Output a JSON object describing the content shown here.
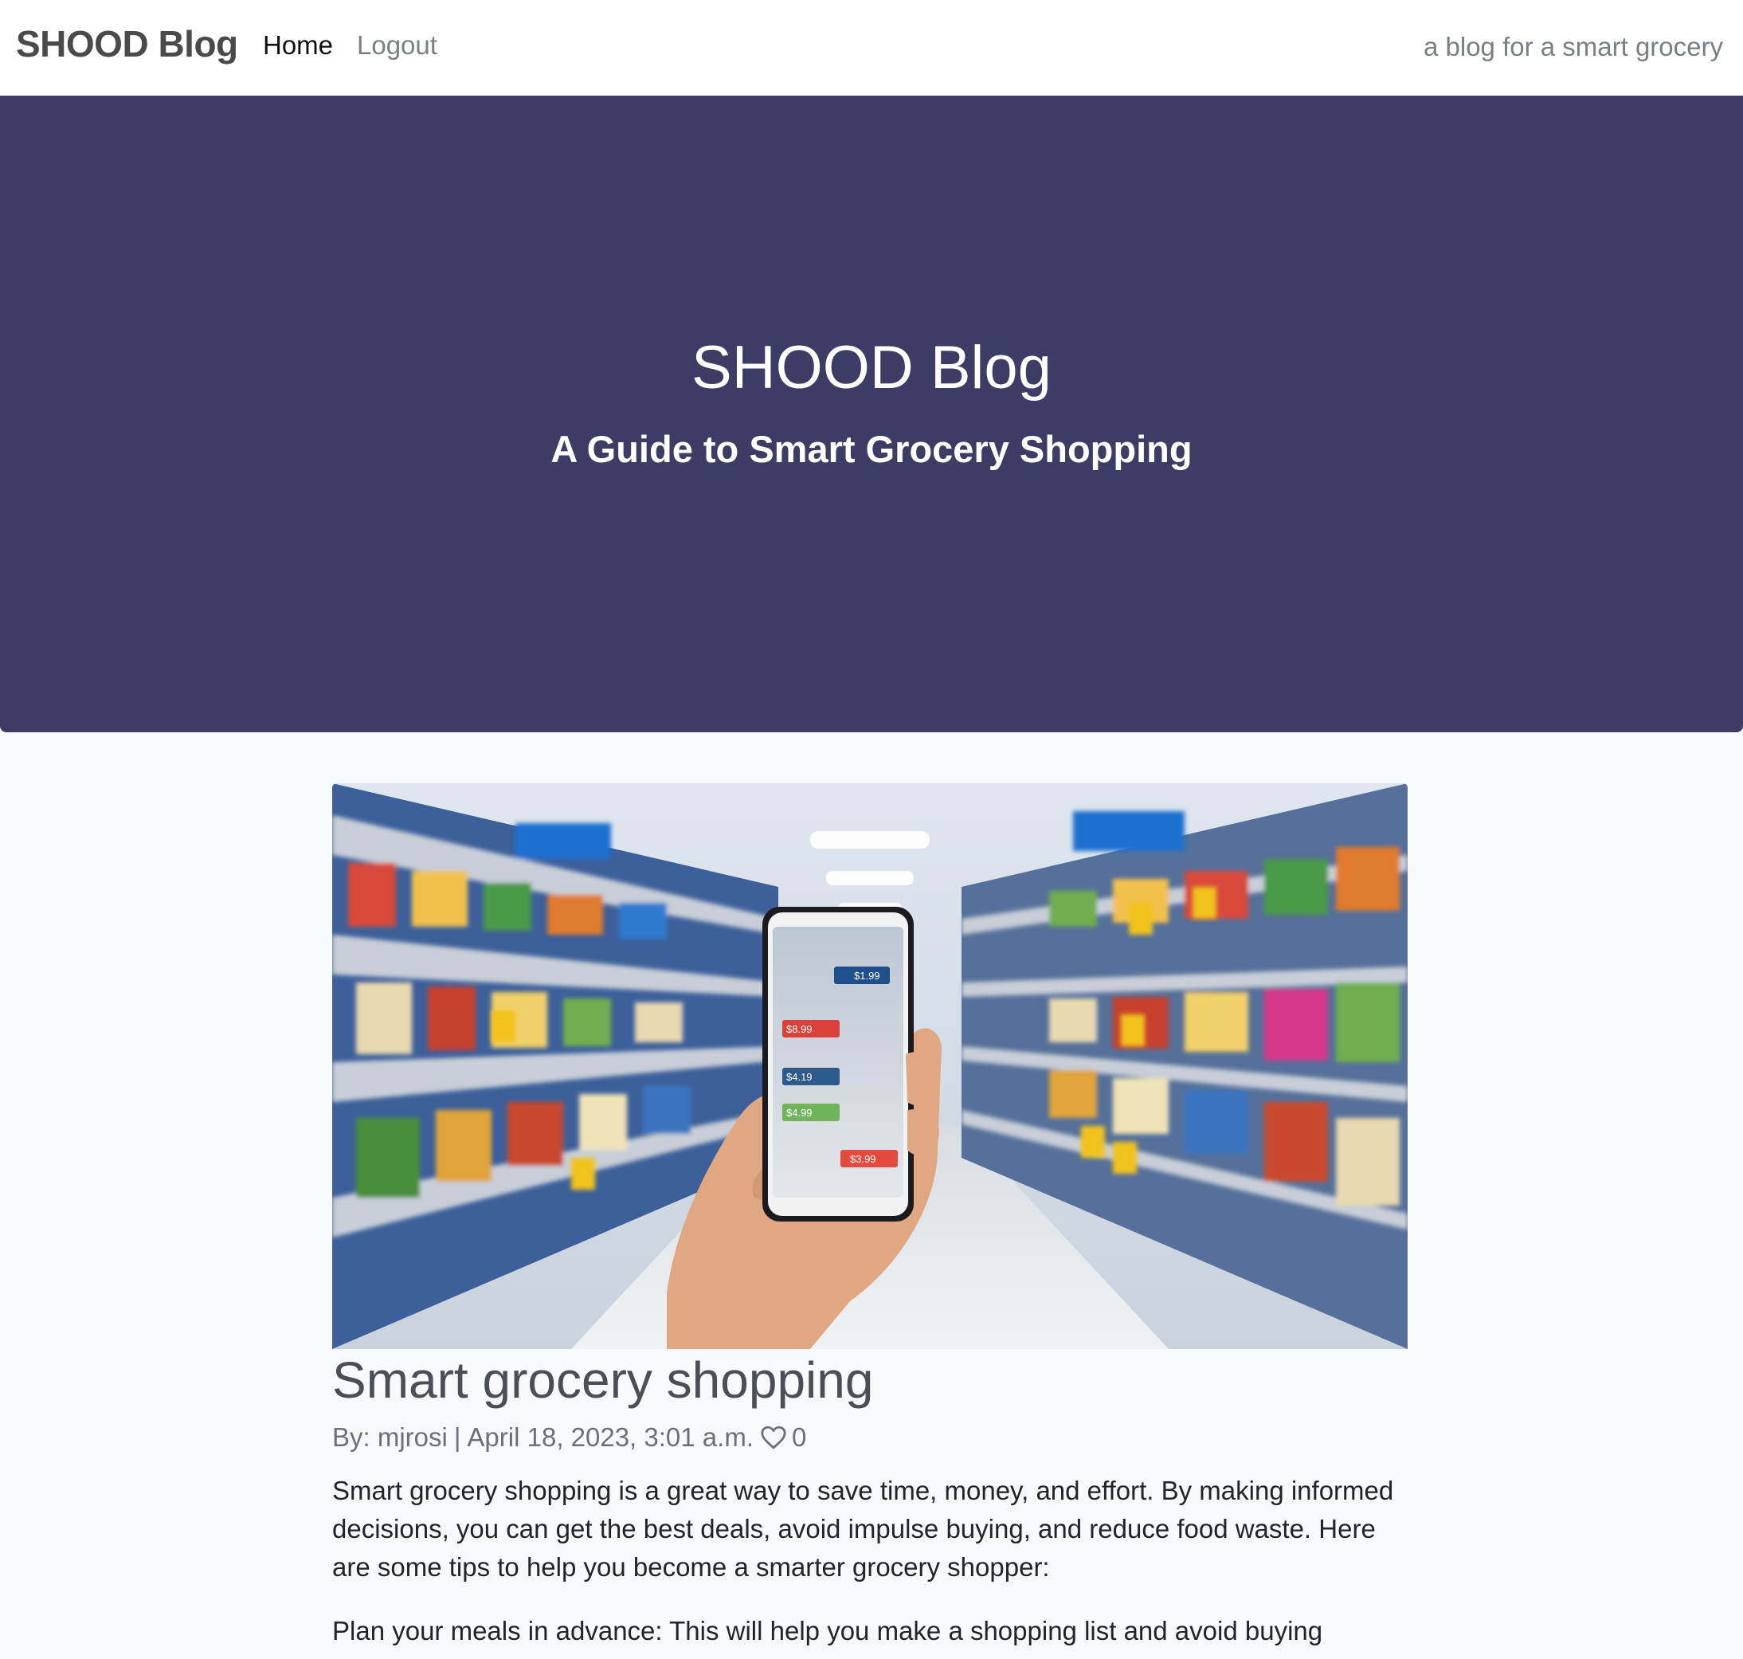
{
  "navbar": {
    "brand": "SHOOD Blog",
    "links": [
      {
        "label": "Home"
      },
      {
        "label": "Logout"
      }
    ],
    "tagline": "a blog for a smart grocery"
  },
  "hero": {
    "title": "SHOOD Blog",
    "subtitle": "A Guide to Smart Grocery Shopping",
    "background_color": "#3c3c64"
  },
  "post": {
    "title": "Smart grocery shopping",
    "meta": {
      "author_prefix": "By: mjrosi",
      "separator": "|",
      "date": "April 18, 2023, 3:01 a.m.",
      "like_icon": "heart-icon",
      "likes": "0"
    },
    "image_price_tags": [
      "$1.99",
      "$8.99",
      "$4.19",
      "$4.99",
      "$3.99"
    ],
    "paragraphs": [
      "Smart grocery shopping is a great way to save time, money, and effort. By making informed decisions, you can get the best deals, avoid impulse buying, and reduce food waste. Here are some tips to help you become a smarter grocery shopper:",
      "Plan your meals in advance: This will help you make a shopping list and avoid buying"
    ]
  }
}
